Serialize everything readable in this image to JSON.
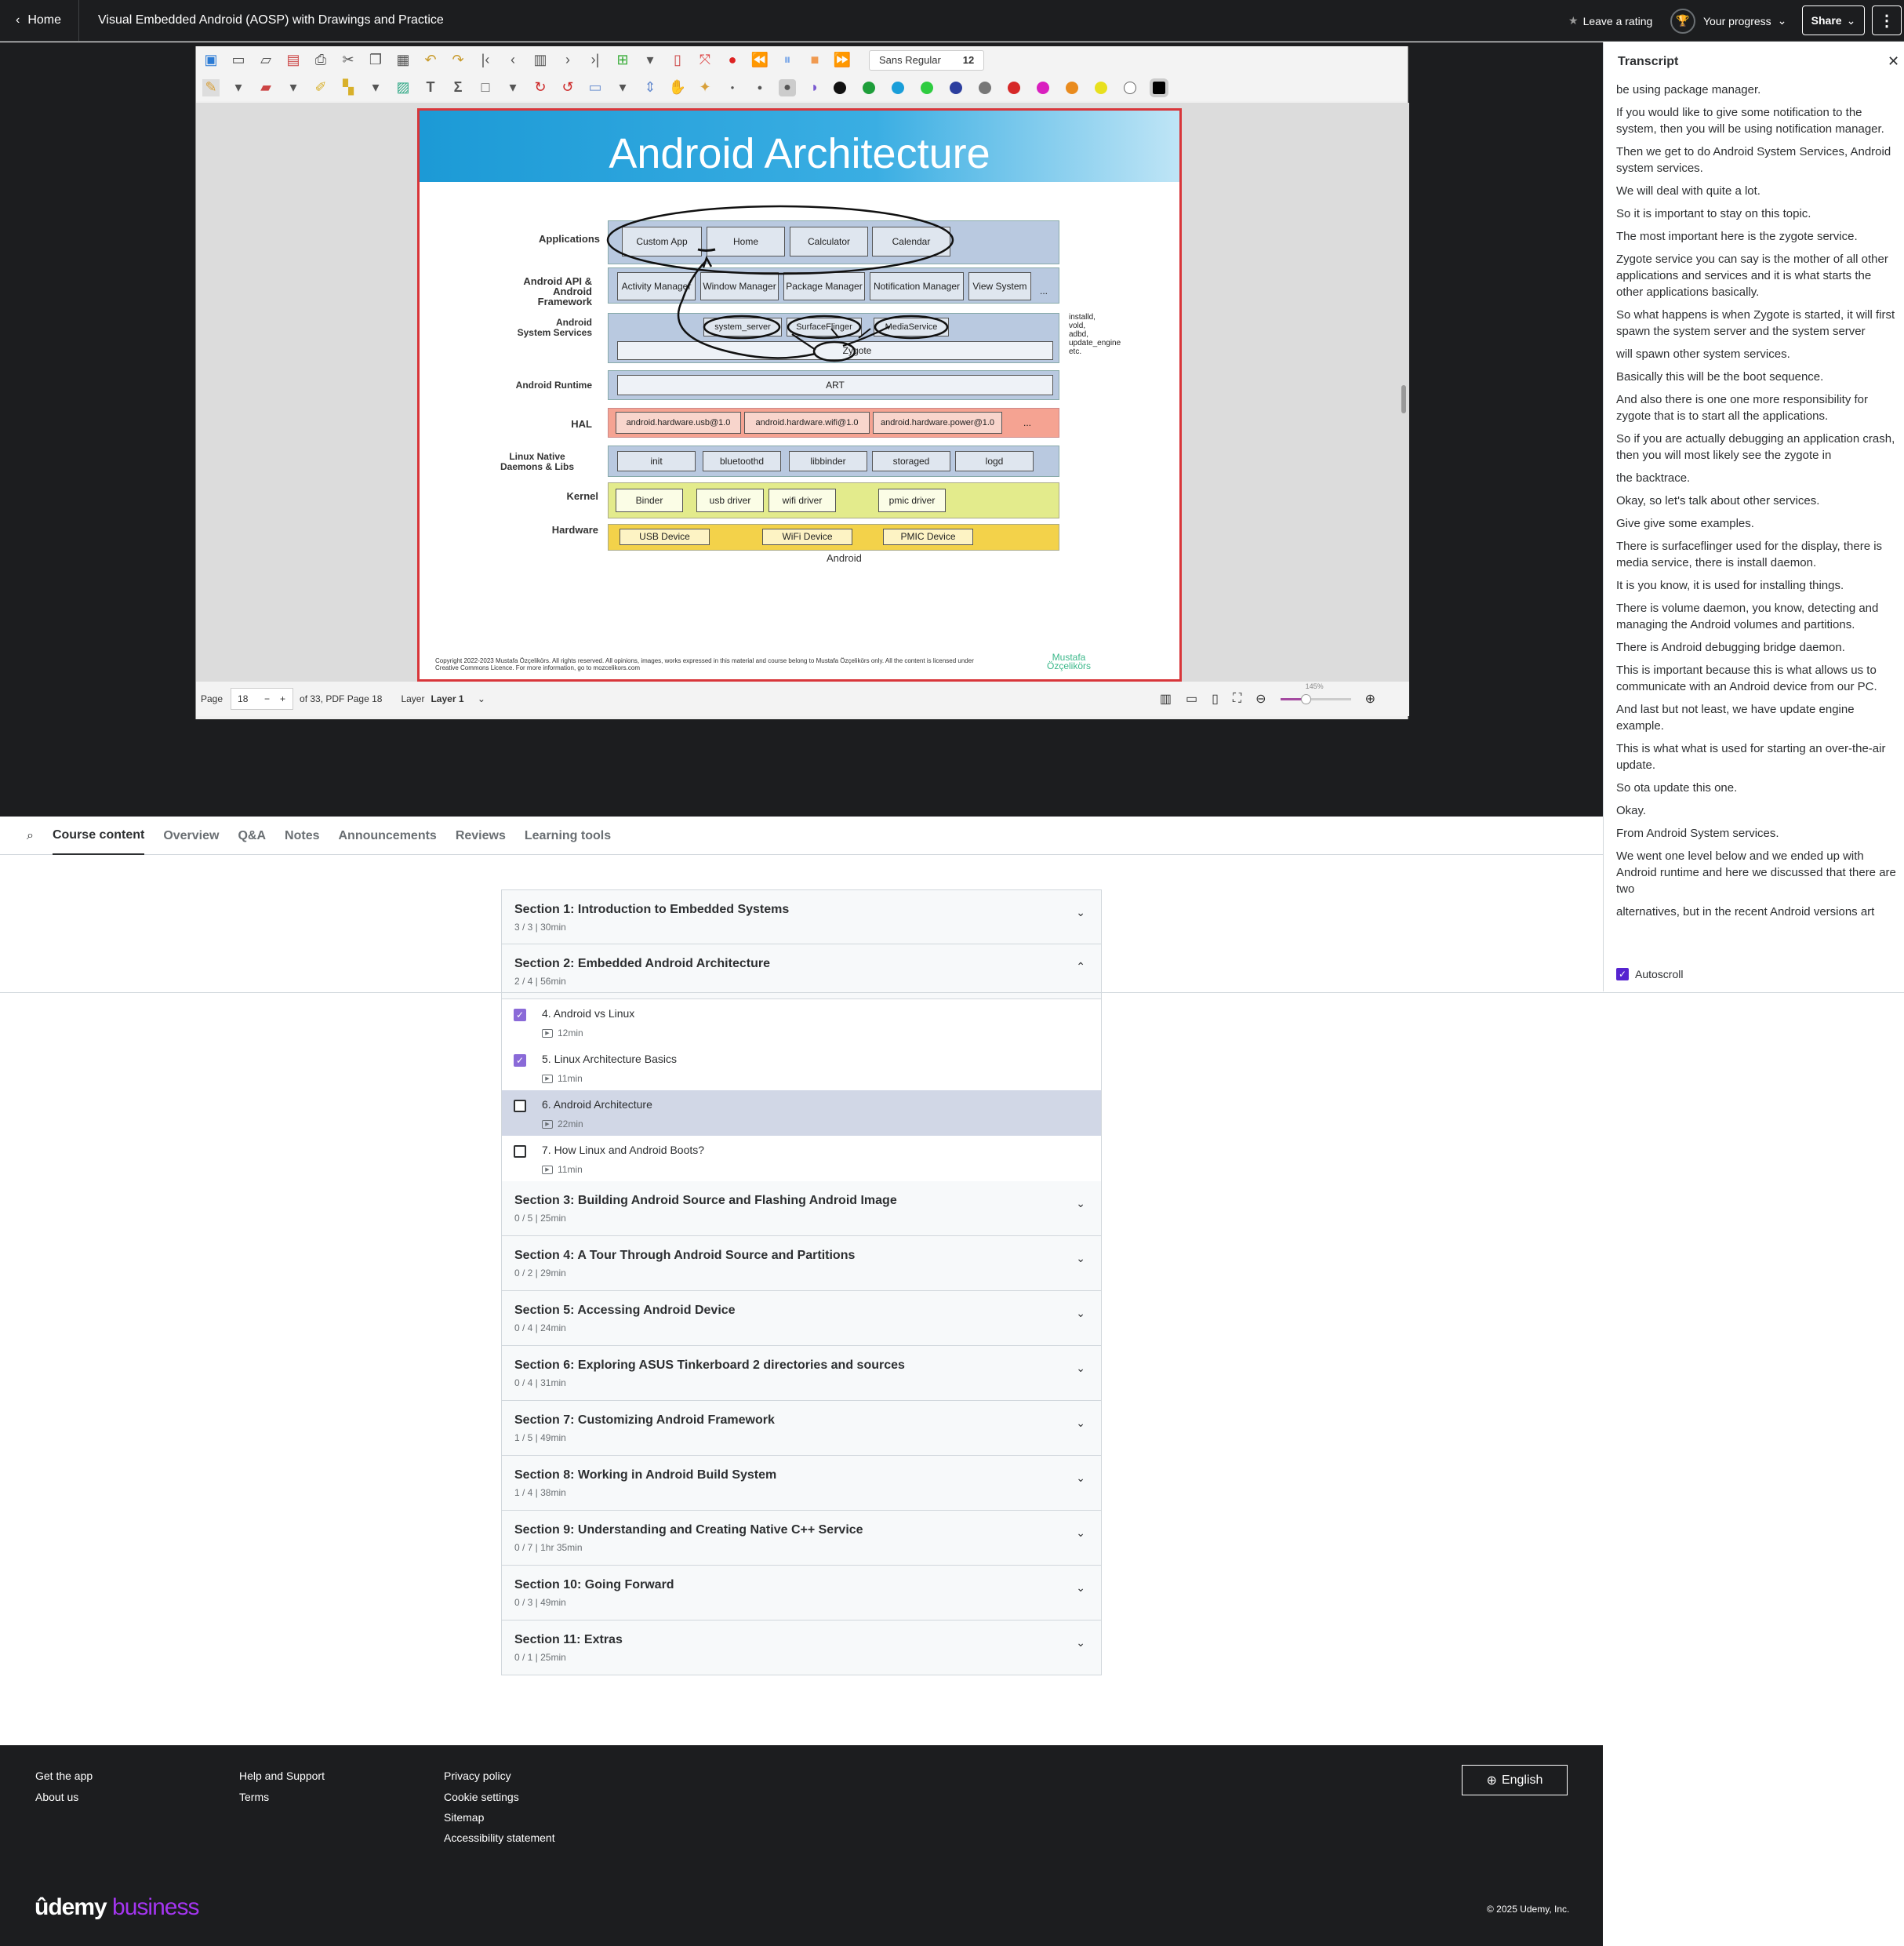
{
  "header": {
    "home_label": "Home",
    "course_title": "Visual Embedded Android (AOSP) with Drawings and Practice",
    "rating_label": "Leave a rating",
    "progress_label": "Your progress",
    "share_label": "Share"
  },
  "viewer": {
    "font_name": "Sans Regular",
    "font_size": "12",
    "page_label": "Page",
    "page_number": "18",
    "page_of": "of 33, PDF Page 18",
    "layer_label": "Layer",
    "layer_value": "Layer 1",
    "zoom": "145%",
    "colors": [
      "#111111",
      "#1e9e3a",
      "#1a9ed9",
      "#2ecc40",
      "#2c3e9e",
      "#777777",
      "#d62828",
      "#d91fbf",
      "#e98b1e",
      "#e8e01e",
      "#ffffff",
      "#000000"
    ]
  },
  "slide": {
    "title": "Android Architecture",
    "layers": {
      "applications": "Applications",
      "api_l1": "Android API &",
      "api_l2": "Android",
      "api_l3": "Framework",
      "services_l1": "Android",
      "services_l2": "System Services",
      "runtime": "Android Runtime",
      "hal": "HAL",
      "native_l1": "Linux Native",
      "native_l2": "Daemons & Libs",
      "kernel": "Kernel",
      "hardware": "Hardware"
    },
    "apps": [
      "Custom App",
      "Home",
      "Calculator",
      "Calendar"
    ],
    "framework": [
      "Activity Manager",
      "Window Manager",
      "Package Manager",
      "Notification Manager",
      "View System",
      "..."
    ],
    "services": [
      "system_server",
      "SurfaceFlinger",
      "MediaService",
      "Zygote"
    ],
    "services_side": [
      "installd,",
      "vold,",
      "adbd,",
      "update_engine",
      "etc."
    ],
    "runtime": "ART",
    "hal": [
      "android.hardware.usb@1.0",
      "android.hardware.wifi@1.0",
      "android.hardware.power@1.0",
      "..."
    ],
    "daemons": [
      "init",
      "bluetoothd",
      "libbinder",
      "storaged",
      "logd"
    ],
    "kernel": [
      "Binder",
      "usb driver",
      "wifi driver",
      "pmic driver"
    ],
    "hardware": [
      "USB Device",
      "WiFi Device",
      "PMIC Device"
    ],
    "caption": "Android",
    "copyright_l1": "Copyright 2022-2023 Mustafa Özçelikörs. All rights reserved. All opinions, images, works expressed in this material and course belong to Mustafa Özçelikörs only. All the content is licensed under",
    "copyright_l2": "Creative Commons Licence. For more information, go to mozcelikors.com",
    "brand_l1": "Mustafa",
    "brand_l2": "Özçelikörs"
  },
  "tabs": [
    "Course content",
    "Overview",
    "Q&A",
    "Notes",
    "Announcements",
    "Reviews",
    "Learning tools"
  ],
  "transcript": {
    "title": "Transcript",
    "autoscroll": "Autoscroll",
    "lines": [
      "be using package manager.",
      "If you would like to give some notification to the system, then you will be using notification manager.",
      "Then we get to do Android System Services, Android system services.",
      "We will deal with quite a lot.",
      "So it is important to stay on this topic.",
      "The most important here is the zygote service.",
      "Zygote service you can say is the mother of all other applications and services and it is what starts the other applications basically.",
      "So what happens is when Zygote is started, it will first spawn the system server and the system server",
      "will spawn other system services.",
      "Basically this will be the boot sequence.",
      "And also there is one one more responsibility for zygote that is to start all the applications.",
      "So if you are actually debugging an application crash, then you will most likely see the zygote in",
      "the backtrace.",
      "Okay, so let's talk about other services.",
      "Give give some examples.",
      "There is surfaceflinger used for the display, there is media service, there is install daemon.",
      "It is you know, it is used for installing things.",
      "There is volume daemon, you know, detecting and managing the Android volumes and partitions.",
      "There is Android debugging bridge daemon.",
      "This is important because this is what allows us to communicate with an Android device from our PC.",
      "And last but not least, we have update engine example.",
      "This is what what is used for starting an over-the-air update.",
      "So ota update this one.",
      "Okay.",
      "From Android System services.",
      "We went one level below and we ended up with Android runtime and here we discussed that there are two",
      "alternatives, but in the recent Android versions art"
    ]
  },
  "sections": [
    {
      "title": "Section 1: Introduction to Embedded Systems",
      "meta": "3 / 3 | 30min",
      "expanded": false
    },
    {
      "title": "Section 2: Embedded Android Architecture",
      "meta": "2 / 4 | 56min",
      "expanded": true
    },
    {
      "title": "Section 3: Building Android Source and Flashing Android Image",
      "meta": "0 / 5 | 25min",
      "expanded": false
    },
    {
      "title": "Section 4: A Tour Through Android Source and Partitions",
      "meta": "0 / 2 | 29min",
      "expanded": false
    },
    {
      "title": "Section 5: Accessing Android Device",
      "meta": "0 / 4 | 24min",
      "expanded": false
    },
    {
      "title": "Section 6: Exploring ASUS Tinkerboard 2 directories and sources",
      "meta": "0 / 4 | 31min",
      "expanded": false
    },
    {
      "title": "Section 7: Customizing Android Framework",
      "meta": "1 / 5 | 49min",
      "expanded": false
    },
    {
      "title": "Section 8: Working in Android Build System",
      "meta": "1 / 4 | 38min",
      "expanded": false
    },
    {
      "title": "Section 9: Understanding and Creating Native C++ Service",
      "meta": "0 / 7 | 1hr 35min",
      "expanded": false
    },
    {
      "title": "Section 10: Going Forward",
      "meta": "0 / 3 | 49min",
      "expanded": false
    },
    {
      "title": "Section 11: Extras",
      "meta": "0 / 1 | 25min",
      "expanded": false
    }
  ],
  "lectures": [
    {
      "title": "4. Android vs Linux",
      "duration": "12min",
      "done": true,
      "current": false
    },
    {
      "title": "5. Linux Architecture Basics",
      "duration": "11min",
      "done": true,
      "current": false
    },
    {
      "title": "6. Android Architecture",
      "duration": "22min",
      "done": false,
      "current": true
    },
    {
      "title": "7. How Linux and Android Boots?",
      "duration": "11min",
      "done": false,
      "current": false
    }
  ],
  "footer": {
    "get_app": "Get the app",
    "about": "About us",
    "help": "Help and Support",
    "terms": "Terms",
    "privacy": "Privacy policy",
    "cookies": "Cookie settings",
    "sitemap": "Sitemap",
    "accessibility": "Accessibility statement",
    "language": "English",
    "logo_main": "ûdemy",
    "logo_biz": "business",
    "copyright": "© 2025 Udemy, Inc."
  }
}
